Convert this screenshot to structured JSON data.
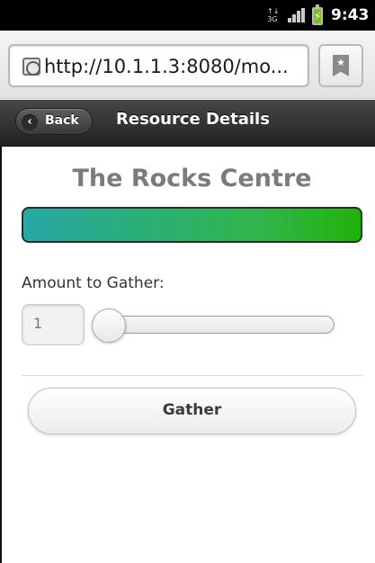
{
  "status_bar": {
    "time": "9:43",
    "network_icon": "3g-data-icon",
    "signal_icon": "signal-icon",
    "battery_icon": "battery-charging-icon"
  },
  "browser": {
    "url": "http://10.1.1.3:8080/mo...",
    "favicon": "globe-icon",
    "bookmark_icon": "bookmark-star-icon"
  },
  "header": {
    "back_label": "Back",
    "title": "Resource Details"
  },
  "resource": {
    "name": "The Rocks Centre",
    "bar_colors": [
      "#26a8a6",
      "#22b20b"
    ]
  },
  "gather": {
    "amount_label": "Amount to Gather:",
    "amount_value": "1",
    "slider_level": 0,
    "button_label": "Gather"
  }
}
